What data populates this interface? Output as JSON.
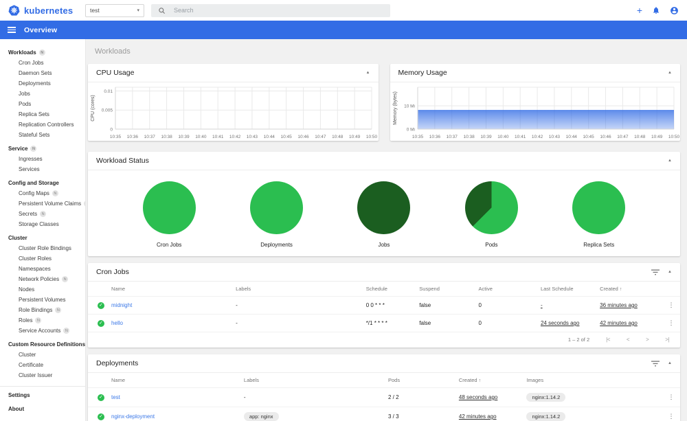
{
  "app": {
    "brand": "kubernetes",
    "namespace": {
      "value": "test"
    },
    "search": {
      "placeholder": "Search"
    },
    "nav": {
      "title": "Overview"
    }
  },
  "icons": {
    "collapse": "▲",
    "sort_asc": "↑",
    "row_menu": "⋮",
    "plus": "+",
    "caret_down": "▾",
    "check": "✓",
    "page_first": "|<",
    "page_prev": "<",
    "page_next": ">",
    "page_last": ">|"
  },
  "colors": {
    "brand_blue": "#326ce5",
    "success_green": "#2bbe50",
    "dark_green": "#1b5e20",
    "link_blue": "#3b78e7"
  },
  "sidebar": {
    "badge_letter": "N",
    "sections": [
      {
        "label": "Workloads",
        "badge": true,
        "items": [
          {
            "label": "Cron Jobs"
          },
          {
            "label": "Daemon Sets"
          },
          {
            "label": "Deployments"
          },
          {
            "label": "Jobs"
          },
          {
            "label": "Pods"
          },
          {
            "label": "Replica Sets"
          },
          {
            "label": "Replication Controllers"
          },
          {
            "label": "Stateful Sets"
          }
        ]
      },
      {
        "label": "Service",
        "badge": true,
        "items": [
          {
            "label": "Ingresses"
          },
          {
            "label": "Services"
          }
        ]
      },
      {
        "label": "Config and Storage",
        "badge": false,
        "items": [
          {
            "label": "Config Maps",
            "badge": true
          },
          {
            "label": "Persistent Volume Claims",
            "badge": true
          },
          {
            "label": "Secrets",
            "badge": true
          },
          {
            "label": "Storage Classes"
          }
        ]
      },
      {
        "label": "Cluster",
        "badge": false,
        "items": [
          {
            "label": "Cluster Role Bindings"
          },
          {
            "label": "Cluster Roles"
          },
          {
            "label": "Namespaces"
          },
          {
            "label": "Network Policies",
            "badge": true
          },
          {
            "label": "Nodes"
          },
          {
            "label": "Persistent Volumes"
          },
          {
            "label": "Role Bindings",
            "badge": true
          },
          {
            "label": "Roles",
            "badge": true
          },
          {
            "label": "Service Accounts",
            "badge": true
          }
        ]
      },
      {
        "label": "Custom Resource Definitions",
        "badge": false,
        "items": [
          {
            "label": "Cluster"
          },
          {
            "label": "Certificate"
          },
          {
            "label": "Cluster Issuer"
          }
        ]
      }
    ],
    "footer_items": [
      {
        "label": "Settings"
      },
      {
        "label": "About"
      }
    ]
  },
  "main": {
    "page_title": "Workloads",
    "cards": {
      "cpu": {
        "title": "CPU Usage"
      },
      "memory": {
        "title": "Memory Usage"
      },
      "workload_status": {
        "title": "Workload Status"
      },
      "cron_jobs": {
        "title": "Cron Jobs",
        "columns": [
          "Name",
          "Labels",
          "Schedule",
          "Suspend",
          "Active",
          "Last Schedule",
          "Created"
        ],
        "rows": [
          {
            "name": "midnight",
            "labels": "-",
            "schedule": "0 0 * * *",
            "suspend": "false",
            "active": "0",
            "last_schedule": "-",
            "created": "36 minutes ago"
          },
          {
            "name": "hello",
            "labels": "-",
            "schedule": "*/1 * * * *",
            "suspend": "false",
            "active": "0",
            "last_schedule": "24 seconds ago",
            "created": "42 minutes ago"
          }
        ],
        "pagination": "1 – 2 of 2"
      },
      "deployments": {
        "title": "Deployments",
        "columns": [
          "Name",
          "Labels",
          "Pods",
          "Created",
          "Images"
        ],
        "rows": [
          {
            "name": "test",
            "labels": "-",
            "pods": "2 / 2",
            "created": "48 seconds ago",
            "images": "nginx:1.14.2"
          },
          {
            "name": "nginx-deployment",
            "labels": "app: nginx",
            "pods": "3 / 3",
            "created": "42 minutes ago",
            "images": "nginx:1.14.2"
          }
        ]
      }
    }
  },
  "chart_data": [
    {
      "id": "cpu",
      "type": "line",
      "title": "CPU Usage",
      "xlabel": "",
      "ylabel": "CPU (cores)",
      "x": [
        "10:35",
        "10:36",
        "10:37",
        "10:38",
        "10:39",
        "10:40",
        "10:41",
        "10:42",
        "10:43",
        "10:44",
        "10:45",
        "10:46",
        "10:47",
        "10:48",
        "10:49",
        "10:50"
      ],
      "yticks": [
        {
          "v": 0,
          "label": "0"
        },
        {
          "v": 0.005,
          "label": "0.005"
        },
        {
          "v": 0.01,
          "label": "0.01"
        }
      ],
      "ylim": [
        0,
        0.011
      ],
      "grid": true,
      "legend": "none",
      "series": [],
      "color": "#326ce5"
    },
    {
      "id": "memory",
      "type": "area",
      "title": "Memory Usage",
      "xlabel": "",
      "ylabel": "Memory (bytes)",
      "x": [
        "10:35",
        "10:36",
        "10:37",
        "10:38",
        "10:39",
        "10:40",
        "10:41",
        "10:42",
        "10:43",
        "10:44",
        "10:45",
        "10:46",
        "10:47",
        "10:48",
        "10:49",
        "10:50"
      ],
      "yticks": [
        {
          "v": 0,
          "label": "0 Mi"
        },
        {
          "v": 10,
          "label": "10 Mi"
        }
      ],
      "ylim": [
        0,
        18
      ],
      "grid": true,
      "legend": "none",
      "series": [
        {
          "name": "Memory usage (Mi)",
          "values": [
            8.1,
            8.1,
            8.1,
            8.1,
            8.1,
            8.1,
            8.1,
            8.1,
            8.1,
            8.1,
            8.1,
            8.1,
            8.1,
            8.1,
            8.1,
            8.1
          ]
        }
      ],
      "color": "#326ce5"
    },
    {
      "id": "workload-status",
      "type": "pie",
      "title": "Workload Status",
      "pies": [
        {
          "label": "Cron Jobs",
          "slices": [
            {
              "pct": 100,
              "color": "#2bbe50"
            }
          ]
        },
        {
          "label": "Deployments",
          "slices": [
            {
              "pct": 100,
              "color": "#2bbe50"
            }
          ]
        },
        {
          "label": "Jobs",
          "slices": [
            {
              "pct": 100,
              "color": "#1b5e20"
            }
          ]
        },
        {
          "label": "Pods",
          "slices": [
            {
              "pct": 62.5,
              "color": "#2bbe50"
            },
            {
              "pct": 37.5,
              "color": "#1b5e20"
            }
          ]
        },
        {
          "label": "Replica Sets",
          "slices": [
            {
              "pct": 100,
              "color": "#2bbe50"
            }
          ]
        }
      ]
    }
  ]
}
